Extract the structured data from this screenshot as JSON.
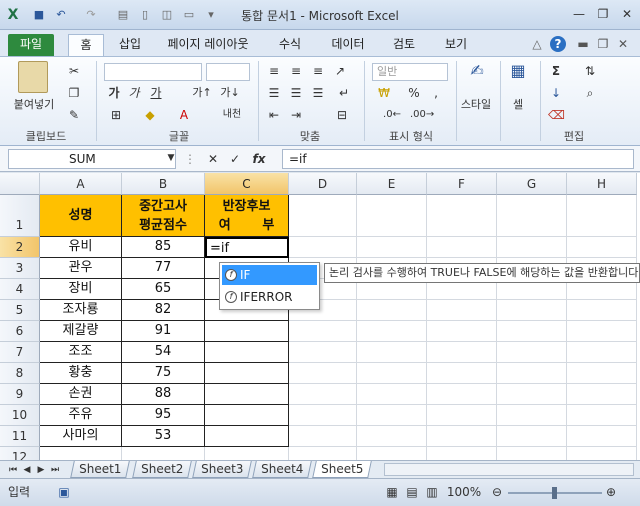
{
  "window": {
    "title": "통합 문서1 - Microsoft Excel"
  },
  "tabs": [
    {
      "label": "파일"
    },
    {
      "label": "홈"
    },
    {
      "label": "삽입"
    },
    {
      "label": "페이지 레이아웃"
    },
    {
      "label": "수식"
    },
    {
      "label": "데이터"
    },
    {
      "label": "검토"
    },
    {
      "label": "보기"
    }
  ],
  "ribbon": {
    "paste_label": "붙여넣기",
    "clipboard_group": "클립보드",
    "font_group": "글꼴",
    "align_group": "맞춤",
    "number_group": "표시 형식",
    "number_format": "일반",
    "style_label": "스타일",
    "cells_label": "셀",
    "edit_group": "편집",
    "font_bold": "가",
    "font_italic": "가",
    "font_underline": "가",
    "percent": "%",
    "sigma": "Σ"
  },
  "formula": {
    "name_box": "SUM",
    "content": "=if",
    "fx": "fx"
  },
  "columns": [
    "A",
    "B",
    "C",
    "D",
    "E",
    "F",
    "G",
    "H"
  ],
  "rows": [
    "1",
    "2",
    "3",
    "4",
    "5",
    "6",
    "7",
    "8",
    "9",
    "10",
    "11",
    "12"
  ],
  "header": {
    "a1": "성명",
    "b1_line1": "중간고사",
    "b1_line2": "평균점수",
    "c1_line1": "반장후보",
    "c1_line2": "여       부"
  },
  "data": [
    {
      "name": "유비",
      "score": "85"
    },
    {
      "name": "관우",
      "score": "77"
    },
    {
      "name": "장비",
      "score": "65"
    },
    {
      "name": "조자룡",
      "score": "82"
    },
    {
      "name": "제갈량",
      "score": "91"
    },
    {
      "name": "조조",
      "score": "54"
    },
    {
      "name": "황충",
      "score": "75"
    },
    {
      "name": "손권",
      "score": "88"
    },
    {
      "name": "주유",
      "score": "95"
    },
    {
      "name": "사마의",
      "score": "53"
    }
  ],
  "editing_cell": "=if",
  "autocomplete": [
    {
      "label": "IF"
    },
    {
      "label": "IFERROR"
    }
  ],
  "tooltip": "논리 검사를 수행하여 TRUE나 FALSE에 해당하는 값을 반환합니다.",
  "sheets": [
    {
      "label": "Sheet1"
    },
    {
      "label": "Sheet2"
    },
    {
      "label": "Sheet3"
    },
    {
      "label": "Sheet4"
    },
    {
      "label": "Sheet5"
    }
  ],
  "status": {
    "mode": "입력",
    "zoom": "100%"
  }
}
